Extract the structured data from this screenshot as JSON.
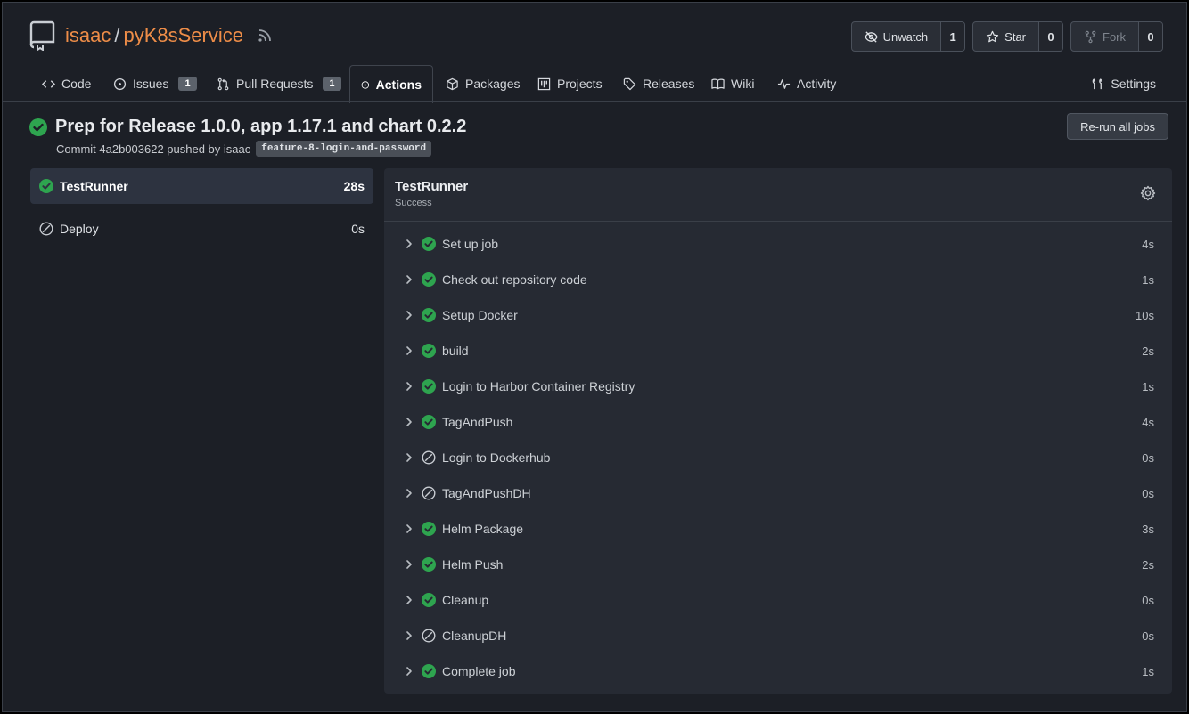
{
  "repo": {
    "owner": "isaac",
    "separator": "/",
    "name": "pyK8sService"
  },
  "header_buttons": {
    "watch": {
      "label": "Unwatch",
      "count": "1"
    },
    "star": {
      "label": "Star",
      "count": "0"
    },
    "fork": {
      "label": "Fork",
      "count": "0"
    }
  },
  "tabs": [
    {
      "label": "Code",
      "icon": "code-icon"
    },
    {
      "label": "Issues",
      "icon": "issue-icon",
      "badge": "1"
    },
    {
      "label": "Pull Requests",
      "icon": "pull-request-icon",
      "badge": "1"
    },
    {
      "label": "Actions",
      "icon": "play-icon"
    },
    {
      "label": "Packages",
      "icon": "package-icon"
    },
    {
      "label": "Projects",
      "icon": "project-icon"
    },
    {
      "label": "Releases",
      "icon": "tag-icon"
    },
    {
      "label": "Wiki",
      "icon": "book-icon"
    },
    {
      "label": "Activity",
      "icon": "pulse-icon"
    },
    {
      "label": "Settings",
      "icon": "tools-icon"
    }
  ],
  "run": {
    "title": "Prep for Release 1.0.0, app 1.17.1 and chart 0.2.2",
    "commit_text": "Commit 4a2b003622 pushed by isaac",
    "branch": "feature-8-login-and-password",
    "rerun_label": "Re-run all jobs"
  },
  "jobs": [
    {
      "name": "TestRunner",
      "duration": "28s",
      "status": "success"
    },
    {
      "name": "Deploy",
      "duration": "0s",
      "status": "skipped"
    }
  ],
  "job_detail": {
    "title": "TestRunner",
    "status": "Success",
    "steps": [
      {
        "name": "Set up job",
        "duration": "4s",
        "status": "success"
      },
      {
        "name": "Check out repository code",
        "duration": "1s",
        "status": "success"
      },
      {
        "name": "Setup Docker",
        "duration": "10s",
        "status": "success"
      },
      {
        "name": "build",
        "duration": "2s",
        "status": "success"
      },
      {
        "name": "Login to Harbor Container Registry",
        "duration": "1s",
        "status": "success"
      },
      {
        "name": "TagAndPush",
        "duration": "4s",
        "status": "success"
      },
      {
        "name": "Login to Dockerhub",
        "duration": "0s",
        "status": "skipped"
      },
      {
        "name": "TagAndPushDH",
        "duration": "0s",
        "status": "skipped"
      },
      {
        "name": "Helm Package",
        "duration": "3s",
        "status": "success"
      },
      {
        "name": "Helm Push",
        "duration": "2s",
        "status": "success"
      },
      {
        "name": "Cleanup",
        "duration": "0s",
        "status": "success"
      },
      {
        "name": "CleanupDH",
        "duration": "0s",
        "status": "skipped"
      },
      {
        "name": "Complete job",
        "duration": "1s",
        "status": "success"
      }
    ]
  },
  "colors": {
    "success": "#2ea44f",
    "accent": "#ee8d48",
    "skipped": "#c9cdd3"
  }
}
